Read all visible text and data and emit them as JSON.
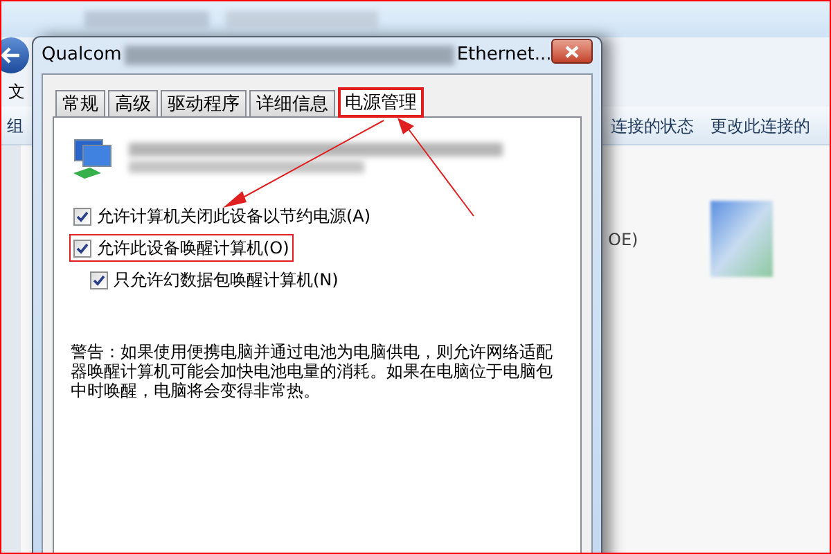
{
  "background_window": {
    "menu_fragment": "文",
    "toolbar_fragment": "组",
    "toolbar_items": [
      "连接的状态",
      "更改此连接的"
    ],
    "list_fragment": "OE)"
  },
  "dialog": {
    "title_start": "Qualcom",
    "title_end": "Ethernet...",
    "tabs": [
      {
        "label": "常规",
        "selected": false,
        "highlighted": false
      },
      {
        "label": "高级",
        "selected": false,
        "highlighted": false
      },
      {
        "label": "驱动程序",
        "selected": false,
        "highlighted": false
      },
      {
        "label": "详细信息",
        "selected": false,
        "highlighted": false
      },
      {
        "label": "电源管理",
        "selected": true,
        "highlighted": true
      }
    ],
    "options": [
      {
        "label": "允许计算机关闭此设备以节约电源(A)",
        "checked": true,
        "highlighted": false
      },
      {
        "label": "允许此设备唤醒计算机(O)",
        "checked": true,
        "highlighted": true,
        "children": [
          {
            "label": "只允许幻数据包唤醒计算机(N)",
            "checked": true,
            "highlighted": false
          }
        ]
      }
    ],
    "warning": "警告：如果使用便携电脑并通过电池为电脑供电，则允许网络适配器唤醒计算机可能会加快电池电量的消耗。如果在电脑位于电脑包中时唤醒，电脑将会变得非常热。"
  }
}
